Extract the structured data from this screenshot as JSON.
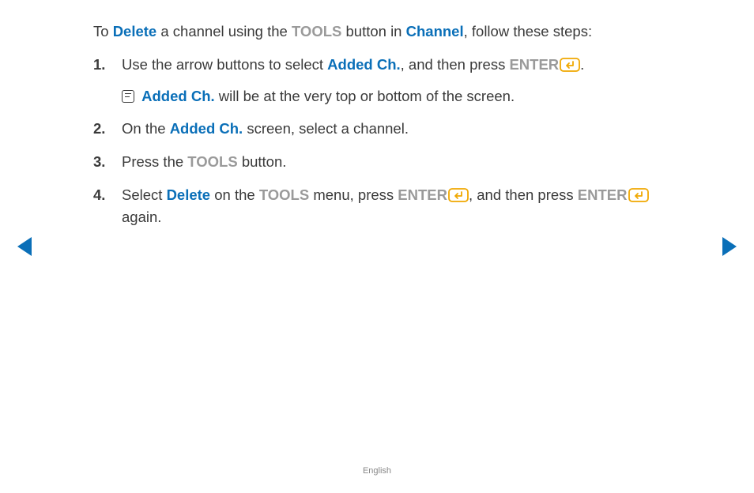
{
  "intro": {
    "p1": "To ",
    "delete": "Delete",
    "p2": " a channel using the ",
    "tools": "TOOLS",
    "p3": " button in ",
    "channel": "Channel",
    "p4": ", follow these steps:"
  },
  "steps": [
    {
      "num": "1.",
      "parts": {
        "a": "Use the arrow buttons to select ",
        "b": "Added Ch.",
        "c": ", and then press ",
        "d": "ENTER",
        "e": "."
      },
      "note": {
        "a": "Added Ch.",
        "b": " will be at the very top or bottom of the screen."
      }
    },
    {
      "num": "2.",
      "parts": {
        "a": "On the ",
        "b": "Added Ch.",
        "c": " screen, select a channel."
      }
    },
    {
      "num": "3.",
      "parts": {
        "a": "Press the ",
        "b": "TOOLS",
        "c": " button."
      }
    },
    {
      "num": "4.",
      "parts": {
        "a": "Select ",
        "b": "Delete",
        "c": " on the ",
        "d": "TOOLS",
        "e": " menu, press ",
        "f": "ENTER",
        "g": ", and then press ",
        "h": "ENTER",
        "i": " again."
      }
    }
  ],
  "footer": "English"
}
